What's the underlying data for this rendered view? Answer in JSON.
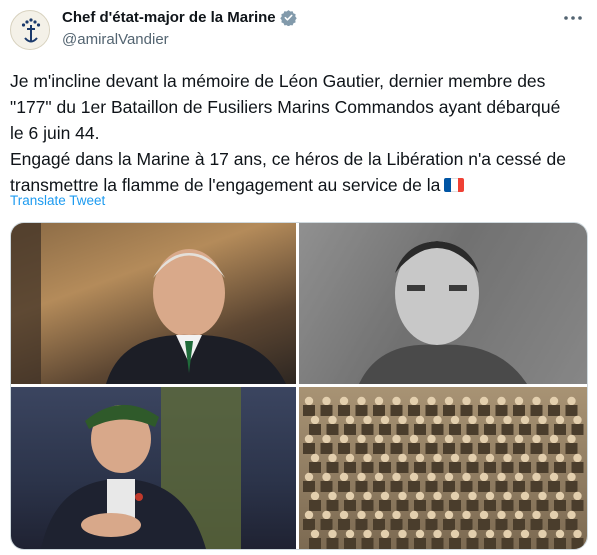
{
  "tweet": {
    "display_name": "Chef d'état-major de la Marine",
    "handle": "@amiralVandier",
    "paragraphs": [
      "Je m'incline devant la mémoire de Léon Gautier, dernier membre des \"177\" du 1er Bataillon de Fusiliers Marins Commandos ayant débarqué le 6 juin 44.",
      "Engagé dans la Marine à 17 ans, ce héros de la Libération n'a cessé de transmettre la flamme de l'engagement au service de la"
    ],
    "flag_icon": "france-flag-icon",
    "translate_label": "Translate Tweet",
    "more_icon": "more-options-icon",
    "verified_icon": "verified-badge-icon"
  },
  "colors": {
    "link": "#1d9bf0",
    "text": "#0f1419",
    "secondary": "#536471",
    "verified_badge": "#829aab",
    "flag_blue": "#0055a4",
    "flag_white": "#ffffff",
    "flag_red": "#ef4135"
  },
  "media": {
    "photos": [
      "portrait-elderly-man-photo",
      "wartime-portrait-young-man-photo",
      "veteran-with-green-beret-photo",
      "commando-group-photo"
    ]
  }
}
